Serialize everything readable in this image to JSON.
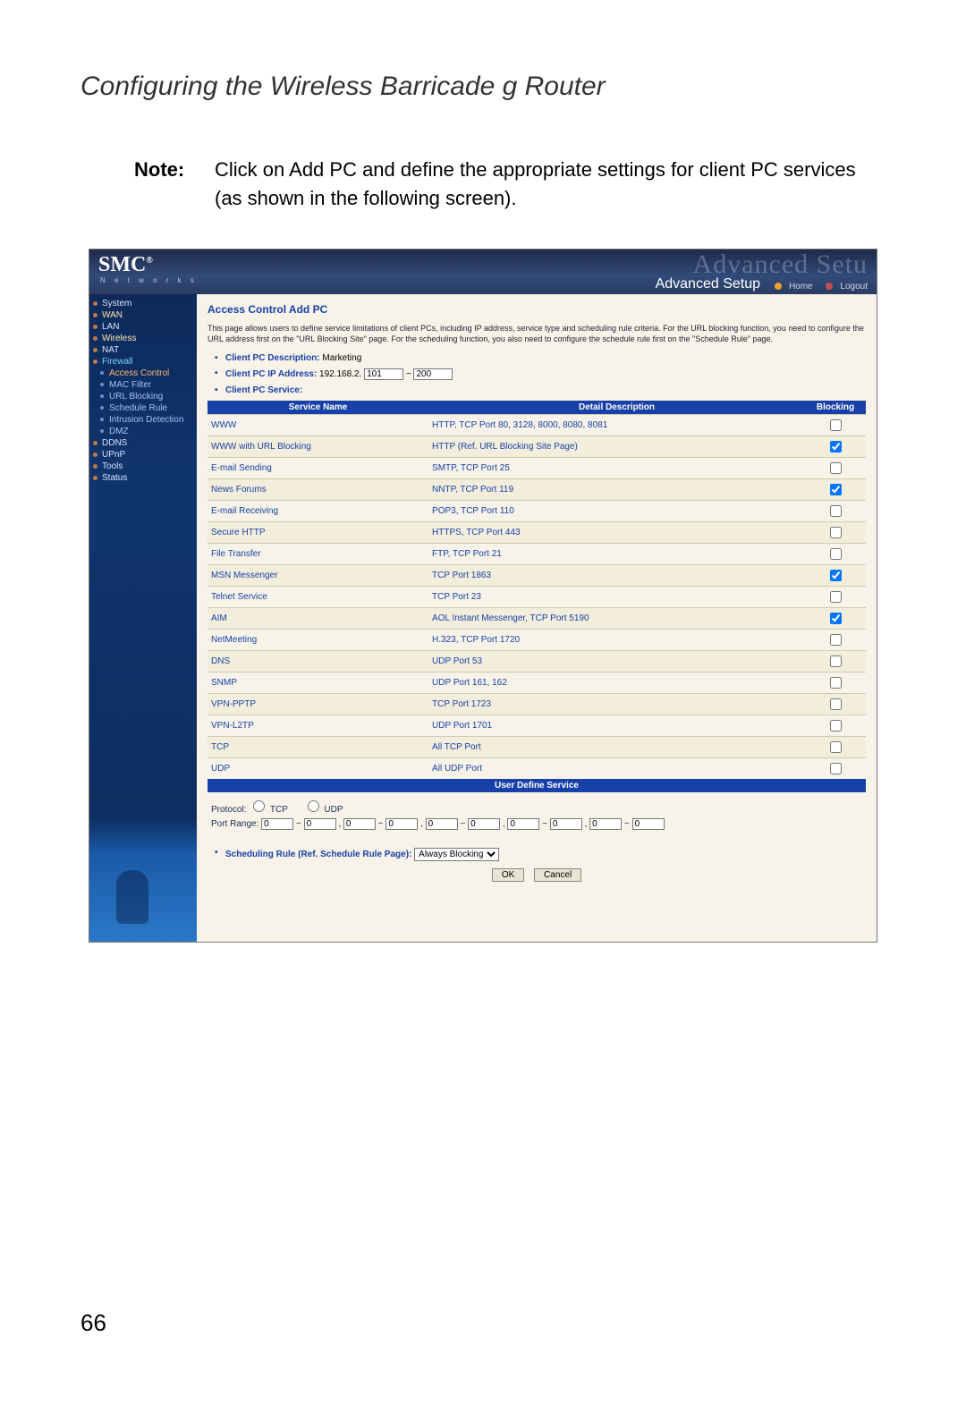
{
  "doc": {
    "title": "Configuring the Wireless Barricade g Router",
    "note_label": "Note:",
    "note_text": "Click on Add PC and define the appropriate settings for client PC services (as shown in the following screen).",
    "page_number": "66"
  },
  "header": {
    "brand": "SMC",
    "brand_reg": "®",
    "brand_sub": "N e t w o r k s",
    "ghost": "Advanced Setu",
    "setup": "Advanced Setup",
    "home": "Home",
    "logout": "Logout"
  },
  "sidebar": {
    "items": [
      {
        "label": "System",
        "type": "item"
      },
      {
        "label": "WAN",
        "type": "item",
        "hi": true
      },
      {
        "label": "LAN",
        "type": "item"
      },
      {
        "label": "Wireless",
        "type": "item",
        "hi": true
      },
      {
        "label": "NAT",
        "type": "item"
      },
      {
        "label": "Firewall",
        "type": "item",
        "cls": "firewall"
      },
      {
        "label": "Access Control",
        "type": "sub",
        "active": true
      },
      {
        "label": "MAC Filter",
        "type": "sub"
      },
      {
        "label": "URL Blocking",
        "type": "sub"
      },
      {
        "label": "Schedule Rule",
        "type": "sub"
      },
      {
        "label": "Intrusion Detection",
        "type": "sub"
      },
      {
        "label": "DMZ",
        "type": "sub"
      },
      {
        "label": "DDNS",
        "type": "item"
      },
      {
        "label": "UPnP",
        "type": "item"
      },
      {
        "label": "Tools",
        "type": "item"
      },
      {
        "label": "Status",
        "type": "item"
      }
    ]
  },
  "content": {
    "title": "Access Control Add PC",
    "desc": "This page allows users to define service limitations of client PCs, including IP address, service type and scheduling rule criteria. For the URL blocking function, you need to configure the URL address first on the \"URL Blocking Site\" page. For the scheduling function, you also need to configure the schedule rule first on the \"Schedule Rule\" page.",
    "desc_label": "Client PC Description:",
    "desc_value": "Marketing",
    "ip_label": "Client PC IP Address:",
    "ip_prefix": "192.168.2.",
    "ip_start": "101",
    "ip_sep": "~",
    "ip_end": "200",
    "service_label": "Client PC Service:",
    "table": {
      "headers": [
        "Service Name",
        "Detail Description",
        "Blocking"
      ],
      "rows": [
        {
          "name": "WWW",
          "detail": "HTTP, TCP Port 80, 3128, 8000, 8080, 8081",
          "blocked": false
        },
        {
          "name": "WWW with URL Blocking",
          "detail": "HTTP (Ref. URL Blocking Site Page)",
          "blocked": true
        },
        {
          "name": "E-mail Sending",
          "detail": "SMTP, TCP Port 25",
          "blocked": false
        },
        {
          "name": "News Forums",
          "detail": "NNTP, TCP Port 119",
          "blocked": true
        },
        {
          "name": "E-mail Receiving",
          "detail": "POP3, TCP Port 110",
          "blocked": false
        },
        {
          "name": "Secure HTTP",
          "detail": "HTTPS, TCP Port 443",
          "blocked": false
        },
        {
          "name": "File Transfer",
          "detail": "FTP, TCP Port 21",
          "blocked": false
        },
        {
          "name": "MSN Messenger",
          "detail": "TCP Port 1863",
          "blocked": true
        },
        {
          "name": "Telnet Service",
          "detail": "TCP Port 23",
          "blocked": false
        },
        {
          "name": "AIM",
          "detail": "AOL Instant Messenger, TCP Port 5190",
          "blocked": true
        },
        {
          "name": "NetMeeting",
          "detail": "H.323, TCP Port 1720",
          "blocked": false
        },
        {
          "name": "DNS",
          "detail": "UDP Port 53",
          "blocked": false
        },
        {
          "name": "SNMP",
          "detail": "UDP Port 161, 162",
          "blocked": false
        },
        {
          "name": "VPN-PPTP",
          "detail": "TCP Port 1723",
          "blocked": false
        },
        {
          "name": "VPN-L2TP",
          "detail": "UDP Port 1701",
          "blocked": false
        },
        {
          "name": "TCP",
          "detail": "All TCP Port",
          "blocked": false
        },
        {
          "name": "UDP",
          "detail": "All UDP Port",
          "blocked": false
        }
      ]
    },
    "uds": {
      "title": "User Define Service",
      "protocol_label": "Protocol:",
      "tcp": "TCP",
      "udp": "UDP",
      "port_label": "Port Range:",
      "zero": "0",
      "sep": "~",
      "comma": ","
    },
    "sched": {
      "label": "Scheduling Rule (Ref. Schedule Rule Page):",
      "value": "Always Blocking"
    },
    "buttons": {
      "ok": "OK",
      "cancel": "Cancel"
    }
  }
}
